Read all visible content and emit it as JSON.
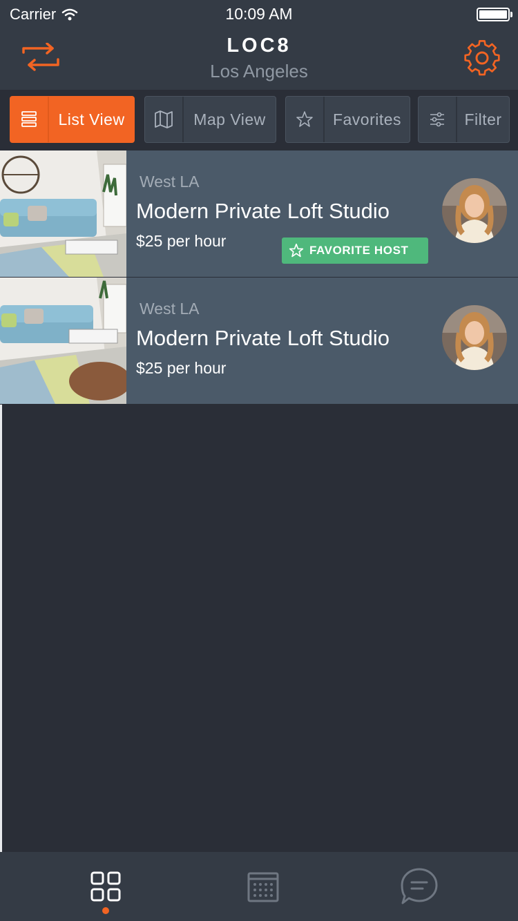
{
  "status": {
    "carrier": "Carrier",
    "time": "10:09 AM"
  },
  "header": {
    "title": "LOC8",
    "city": "Los Angeles"
  },
  "toolbar": {
    "list_view": "List View",
    "map_view": "Map View",
    "favorites": "Favorites",
    "filter": "Filter"
  },
  "listings": [
    {
      "area": "West LA",
      "name": "Modern Private Loft Studio",
      "price": "$25 per hour",
      "badge": "FAVORITE HOST"
    },
    {
      "area": "West LA",
      "name": "Modern Private Loft Studio",
      "price": "$25 per hour"
    }
  ],
  "colors": {
    "accent": "#f26423",
    "badge": "#4fb87c",
    "card": "#4b5a69",
    "background": "#2a2e37"
  },
  "icons": [
    "repeat-icon",
    "gear-icon",
    "list-icon",
    "map-icon",
    "star-icon",
    "sliders-icon",
    "grid-icon",
    "calendar-icon",
    "chat-icon"
  ]
}
